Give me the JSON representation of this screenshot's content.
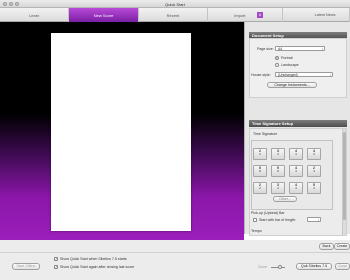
{
  "window": {
    "title": "Quick Start"
  },
  "tabs": [
    {
      "label": "Learn"
    },
    {
      "label": "New Score"
    },
    {
      "label": "Recent"
    },
    {
      "label": "Import"
    },
    {
      "label": "#"
    },
    {
      "label": "Latest News"
    }
  ],
  "document_setup": {
    "heading": "Document Setup",
    "page_size_label": "Page size:",
    "page_size_value": "A4",
    "orientation": {
      "portrait": "Portrait",
      "landscape": "Landscape",
      "selected": "Portrait"
    },
    "house_style_label": "House style:",
    "house_style_value": "(Unchanged)",
    "change_instruments": "Change Instruments..."
  },
  "time_signature": {
    "heading": "Time Signature Setup",
    "group_label": "Time Signature",
    "items": [
      {
        "num": "2",
        "den": "2"
      },
      {
        "num": "3",
        "den": "4"
      },
      {
        "num": "4",
        "den": "4"
      },
      {
        "num": "4",
        "den": "4"
      },
      {
        "num": "6",
        "den": "8"
      },
      {
        "num": "9",
        "den": "8"
      },
      {
        "num": "4",
        "den": "4"
      },
      {
        "num": "2",
        "den": "4"
      },
      {
        "num": "2",
        "den": "2"
      },
      {
        "num": "3",
        "den": "4"
      },
      {
        "num": "4",
        "den": "4"
      },
      {
        "num": "5",
        "den": "4"
      }
    ],
    "other_button": "Other...",
    "pickup_label": "Pick-up (Upbeat) Bar",
    "start_with_bar": "Start with bar of length:",
    "tempo_label": "Tempo"
  },
  "footer": {
    "back": "Back",
    "create": "Create",
    "start_offline": "Start Offline",
    "show_quickstart": "Show Quick Start when Sibelius 7.5 starts",
    "show_again": "Show Quick Start again after closing last score",
    "zoom_label": "Zoom",
    "quit": "Quit Sibelius 7.5",
    "close": "Close"
  }
}
